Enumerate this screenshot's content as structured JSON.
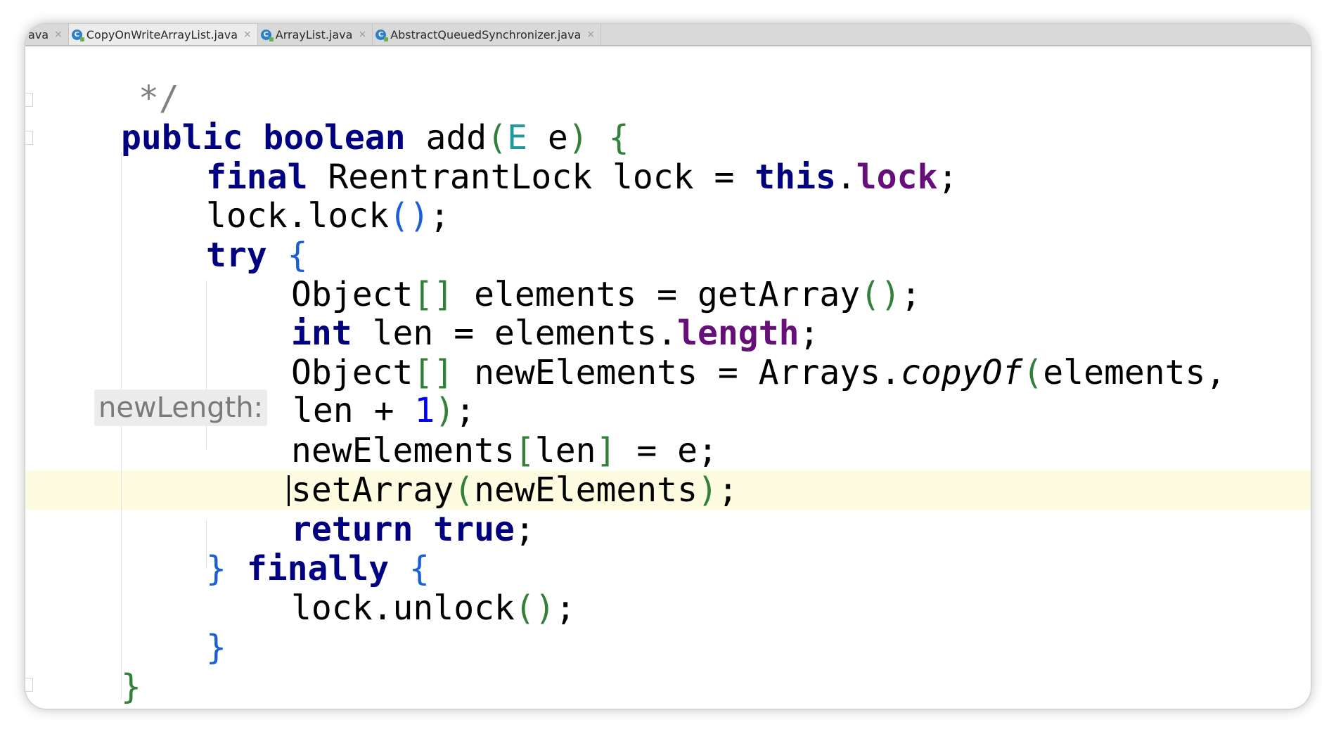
{
  "tabs": [
    {
      "label": "ava",
      "active": false,
      "icon": "none"
    },
    {
      "label": "CopyOnWriteArrayList.java",
      "active": true,
      "icon": "java-class-icon"
    },
    {
      "label": "ArrayList.java",
      "active": false,
      "icon": "java-class-icon"
    },
    {
      "label": "AbstractQueuedSynchronizer.java",
      "active": false,
      "icon": "java-class-icon"
    }
  ],
  "tab_close_glyph": "×",
  "tab_icon_letter": "C",
  "inlay_hint": "newLength:",
  "code": {
    "comment_end": "*/",
    "l_public": "public",
    "l_boolean": "boolean",
    "l_add": "add",
    "l_lp": "(",
    "l_E": "E",
    "l_e": "e",
    "l_rp": ")",
    "l_lb": "{",
    "final": "final",
    "reentrant": "ReentrantLock lock =",
    "this": "this",
    "dot": ".",
    "lock_field": "lock",
    "semi": ";",
    "lock_call": "lock.lock",
    "parens": "()",
    "try": "try",
    "obj_arr": "Object",
    "brackets": "[]",
    "elements_decl": "elements = getArray",
    "int": "int",
    "len_decl": "len = elements.",
    "length": "length",
    "new_decl": "newElements = Arrays.",
    "copyOf": "copyOf",
    "copy_args": "elements,",
    "len_plus": "len + ",
    "one": "1",
    "assign_left": "newElements",
    "lbr": "[",
    "len": "len",
    "rbr": "]",
    "assign_right": "= e;",
    "setArray": "setArray",
    "newElements_arg": "newElements",
    "return": "return",
    "true": "true",
    "finally": "finally",
    "unlock_call": "lock.unlock",
    "rb": "}"
  },
  "colors": {
    "keyword": "#000080",
    "field": "#660e7a",
    "number": "#0000ff",
    "type_param": "#20999d",
    "caret_line": "#fdfbe0"
  }
}
